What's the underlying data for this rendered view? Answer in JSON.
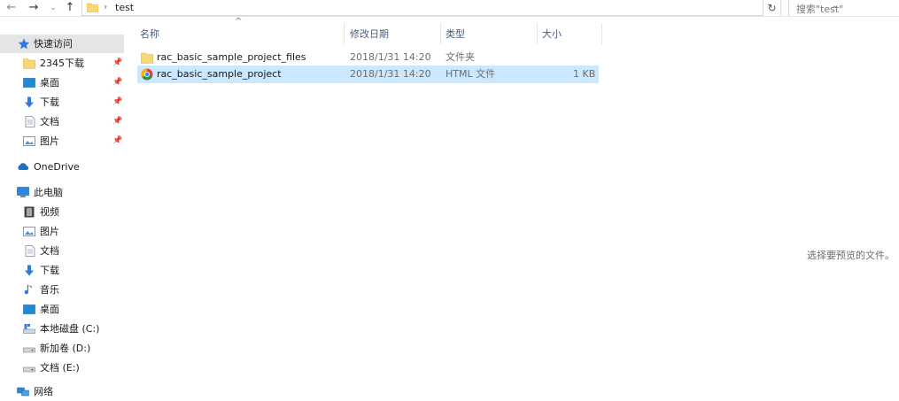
{
  "window": {
    "address": {
      "path_segment": "test"
    },
    "search": {
      "placeholder": "搜索\"test\""
    }
  },
  "sidebar": {
    "quick_access": {
      "label": "快速访问",
      "items": [
        {
          "label": "2345下载",
          "icon": "folder-icon",
          "pinned": true
        },
        {
          "label": "桌面",
          "icon": "desktop-icon",
          "pinned": true
        },
        {
          "label": "下载",
          "icon": "download-icon",
          "pinned": true
        },
        {
          "label": "文档",
          "icon": "document-icon",
          "pinned": true
        },
        {
          "label": "图片",
          "icon": "pictures-icon",
          "pinned": true
        }
      ]
    },
    "onedrive": {
      "label": "OneDrive"
    },
    "this_pc": {
      "label": "此电脑",
      "items": [
        {
          "label": "视频",
          "icon": "video-icon"
        },
        {
          "label": "图片",
          "icon": "pictures-icon"
        },
        {
          "label": "文档",
          "icon": "document-icon"
        },
        {
          "label": "下载",
          "icon": "download-icon"
        },
        {
          "label": "音乐",
          "icon": "music-icon"
        },
        {
          "label": "桌面",
          "icon": "desktop-icon"
        },
        {
          "label": "本地磁盘 (C:)",
          "icon": "system-drive-icon"
        },
        {
          "label": "新加卷 (D:)",
          "icon": "drive-icon"
        },
        {
          "label": "文档 (E:)",
          "icon": "drive-icon"
        }
      ]
    },
    "network": {
      "label": "网络"
    }
  },
  "file_list": {
    "columns": {
      "name": "名称",
      "modified": "修改日期",
      "type": "类型",
      "size": "大小"
    },
    "rows": [
      {
        "name": "rac_basic_sample_project_files",
        "modified": "2018/1/31 14:20",
        "type": "文件夹",
        "size": "",
        "icon": "folder-icon",
        "selected": false
      },
      {
        "name": "rac_basic_sample_project",
        "modified": "2018/1/31 14:20",
        "type": "HTML 文件",
        "size": "1 KB",
        "icon": "chrome-icon",
        "selected": true
      }
    ]
  },
  "preview_pane": {
    "message": "选择要预览的文件。"
  },
  "colors": {
    "selection": "#cce8ff",
    "nav_selected": "#e5e5e5",
    "header_text": "#4c607a",
    "folder": "#f8d775"
  }
}
